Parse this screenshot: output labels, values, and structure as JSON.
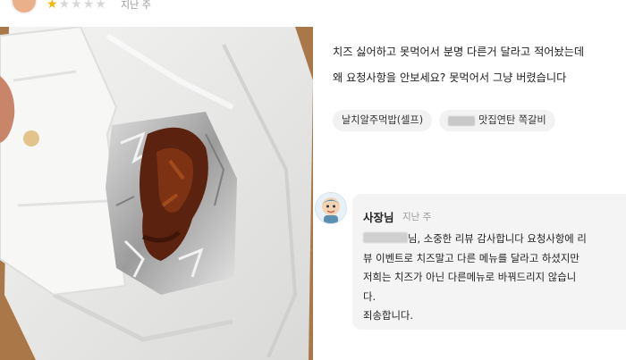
{
  "rating": {
    "stars_filled": 1,
    "stars_total": 5,
    "time": "지난 주"
  },
  "review": {
    "lines": [
      "치즈 싫어하고 못먹어서 분명 다른거 달라고 적어놨는데",
      "왜 요청사항을 안보세요? 못먹어서 그냥 버렸습니다"
    ]
  },
  "tags": [
    {
      "label": "날치알주먹밥(셀프)"
    },
    {
      "label": "맛집연탄 쪽갈비"
    }
  ],
  "owner_reply": {
    "name": "사장님",
    "time": "지난 주",
    "line1_after_name": "님, 소중한 리뷰 감사합니다 요청사항에 리",
    "lines": [
      "뷰 이벤트로 치즈말고 다른 메뉴를 달라고 하셨지만",
      "저희는 치즈가 아닌 다른메뉴로 바꿔드리지 않습니",
      "다.",
      "죄송합니다."
    ]
  }
}
